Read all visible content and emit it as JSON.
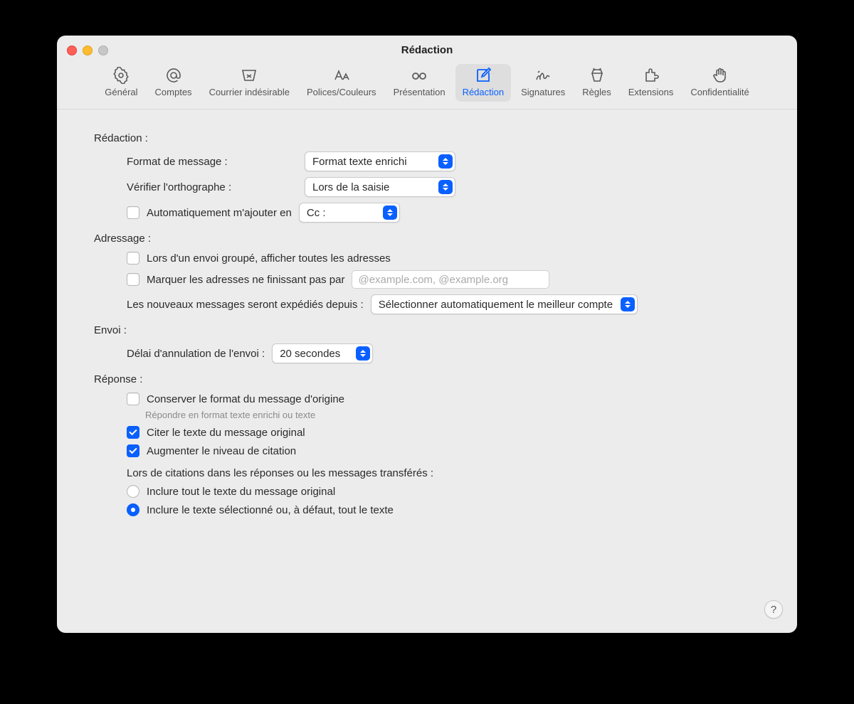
{
  "window": {
    "title": "Rédaction"
  },
  "toolbar": {
    "items": [
      {
        "label": "Général"
      },
      {
        "label": "Comptes"
      },
      {
        "label": "Courrier indésirable"
      },
      {
        "label": "Polices/Couleurs"
      },
      {
        "label": "Présentation"
      },
      {
        "label": "Rédaction"
      },
      {
        "label": "Signatures"
      },
      {
        "label": "Règles"
      },
      {
        "label": "Extensions"
      },
      {
        "label": "Confidentialité"
      }
    ],
    "active_index": 5
  },
  "sections": {
    "redaction": {
      "heading": "Rédaction :",
      "format_label": "Format de message :",
      "format_value": "Format texte enrichi",
      "spell_label": "Vérifier l'orthographe :",
      "spell_value": "Lors de la saisie",
      "auto_add_label": "Automatiquement m'ajouter en",
      "auto_add_value": "Cc :"
    },
    "addressing": {
      "heading": "Adressage :",
      "group_label": "Lors d'un envoi groupé, afficher toutes les adresses",
      "mark_label": "Marquer les adresses ne finissant pas par",
      "mark_placeholder": "@example.com, @example.org",
      "send_from_label": "Les nouveaux messages seront expédiés depuis :",
      "send_from_value": "Sélectionner automatiquement le meilleur compte"
    },
    "sending": {
      "heading": "Envoi :",
      "undo_label": "Délai d'annulation de l'envoi :",
      "undo_value": "20 secondes"
    },
    "reply": {
      "heading": "Réponse :",
      "keep_format_label": "Conserver le format du message d'origine",
      "keep_format_hint": "Répondre en format texte enrichi ou texte",
      "quote_label": "Citer le texte du message original",
      "increase_label": "Augmenter le niveau de citation",
      "when_quoting_label": "Lors de citations dans les réponses ou les messages transférés :",
      "radio_all": "Inclure tout le texte du message original",
      "radio_selected": "Inclure le texte sélectionné ou, à défaut, tout le texte"
    }
  },
  "help": "?"
}
